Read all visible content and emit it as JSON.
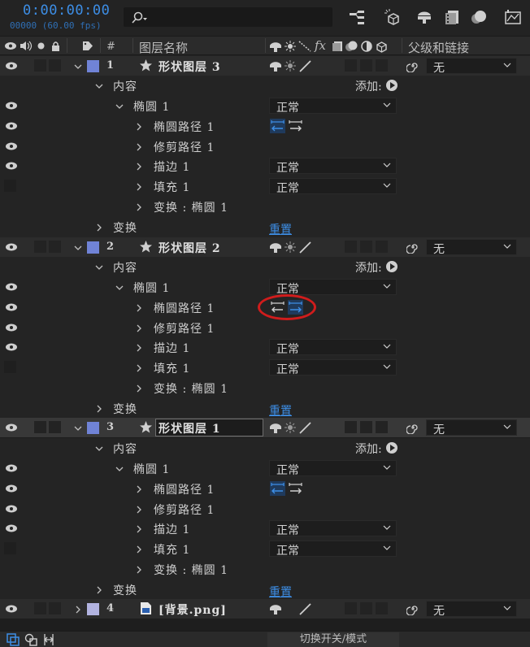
{
  "header": {
    "timecode": "0:00:00:00",
    "fps_readout": "00000 (60.00 fps)",
    "search": {
      "placeholder": ""
    }
  },
  "columns": {
    "number": "#",
    "layer_name": "图层名称",
    "switches_fx": "fx",
    "parent_link": "父级和链接"
  },
  "labels": {
    "add": "添加:",
    "reset": "重置",
    "toggle_switches": "切换开关/模式"
  },
  "colors": {
    "accent_blue": "#3d8ee6",
    "label_shape": "#7083d6",
    "label_bg": "#b2b3e0",
    "highlight": "#d01c1c"
  },
  "layers": [
    {
      "number": "1",
      "name": "形状图层 3",
      "icon": "star-icon",
      "parent": "无",
      "contents": "内容",
      "ellipse": "椭圆 1",
      "ellipse_mode": "正常",
      "ellipse_path": "椭圆路径 1",
      "trim": "修剪路径 1",
      "stroke": "描边 1",
      "stroke_mode": "正常",
      "fill": "填充 1",
      "fill_mode": "正常",
      "transform_ellipse": "变换 : 椭圆 1",
      "transform": "变换"
    },
    {
      "number": "2",
      "name": "形状图层 2",
      "icon": "star-icon",
      "parent": "无",
      "contents": "内容",
      "ellipse": "椭圆 1",
      "ellipse_mode": "正常",
      "ellipse_path": "椭圆路径 1",
      "trim": "修剪路径 1",
      "stroke": "描边 1",
      "stroke_mode": "正常",
      "fill": "填充 1",
      "fill_mode": "正常",
      "transform_ellipse": "变换 : 椭圆 1",
      "transform": "变换"
    },
    {
      "number": "3",
      "name": "形状图层 1",
      "icon": "star-icon",
      "parent": "无",
      "contents": "内容",
      "ellipse": "椭圆 1",
      "ellipse_mode": "正常",
      "ellipse_path": "椭圆路径 1",
      "trim": "修剪路径 1",
      "stroke": "描边 1",
      "stroke_mode": "正常",
      "fill": "填充 1",
      "fill_mode": "正常",
      "transform_ellipse": "变换 : 椭圆 1",
      "transform": "变换"
    },
    {
      "number": "4",
      "name": "[背景.png]",
      "icon": "image-file-icon",
      "parent": "无"
    }
  ]
}
